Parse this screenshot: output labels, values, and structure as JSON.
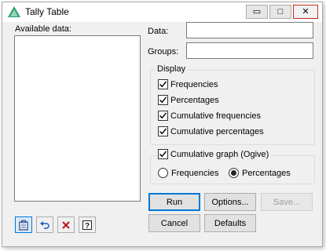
{
  "window": {
    "title": "Tally Table",
    "minimize_glyph": "▭",
    "maximize_glyph": "□",
    "close_glyph": "✕"
  },
  "available_data": {
    "label": "Available data:"
  },
  "fields": {
    "data": {
      "label": "Data:",
      "value": ""
    },
    "groups": {
      "label": "Groups:",
      "value": ""
    }
  },
  "display": {
    "title": "Display",
    "options": [
      {
        "label": "Frequencies",
        "checked": true
      },
      {
        "label": "Percentages",
        "checked": true
      },
      {
        "label": "Cumulative frequencies",
        "checked": true
      },
      {
        "label": "Cumulative percentages",
        "checked": true
      }
    ]
  },
  "cumulative_graph": {
    "label": "Cumulative graph (Ogive)",
    "checked": true,
    "radios": [
      {
        "label": "Frequencies",
        "selected": false
      },
      {
        "label": "Percentages",
        "selected": true
      }
    ]
  },
  "buttons": {
    "run": "Run",
    "options": "Options...",
    "save": "Save...",
    "cancel": "Cancel",
    "defaults": "Defaults"
  },
  "toolbar_icons": [
    "copy-to-data-icon",
    "undo-icon",
    "clear-icon",
    "help-icon"
  ],
  "colors": {
    "accent": "#0078d7",
    "close_red": "#c42b1c",
    "icon_green": "#2e9f6a"
  }
}
